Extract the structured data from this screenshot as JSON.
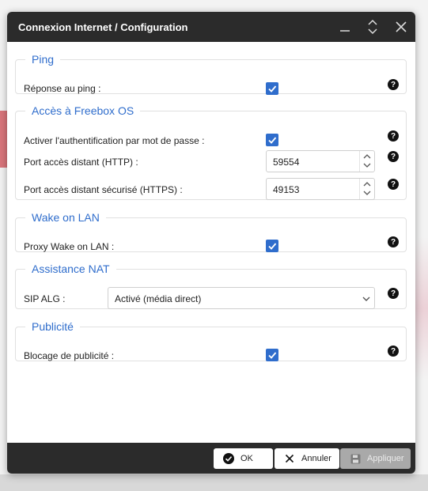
{
  "window": {
    "title": "Connexion Internet / Configuration"
  },
  "sections": {
    "ping": {
      "title": "Ping",
      "reply_label": "Réponse au ping :",
      "reply_checked": true
    },
    "freebox_os": {
      "title": "Accès à Freebox OS",
      "auth_label": "Activer l'authentification par mot de passe :",
      "auth_checked": true,
      "http_label": "Port accès distant (HTTP) :",
      "http_value": "59554",
      "https_label": "Port accès distant sécurisé (HTTPS) :",
      "https_value": "49153"
    },
    "wol": {
      "title": "Wake on LAN",
      "proxy_label": "Proxy Wake on LAN :",
      "proxy_checked": true
    },
    "nat": {
      "title": "Assistance NAT",
      "sip_label": "SIP ALG :",
      "sip_value": "Activé (média direct)"
    },
    "ads": {
      "title": "Publicité",
      "block_label": "Blocage de publicité :",
      "block_checked": true
    }
  },
  "footer": {
    "ok_label": "OK",
    "cancel_label": "Annuler",
    "apply_label": "Appliquer"
  },
  "icons": {
    "help": "?",
    "minimize": "minimize-icon",
    "maximize": "maximize-icon",
    "close": "close-icon"
  },
  "colors": {
    "accent": "#2f6dcc",
    "titlebar": "#2b2b2b",
    "apply_disabled": "#a9a9a9"
  }
}
